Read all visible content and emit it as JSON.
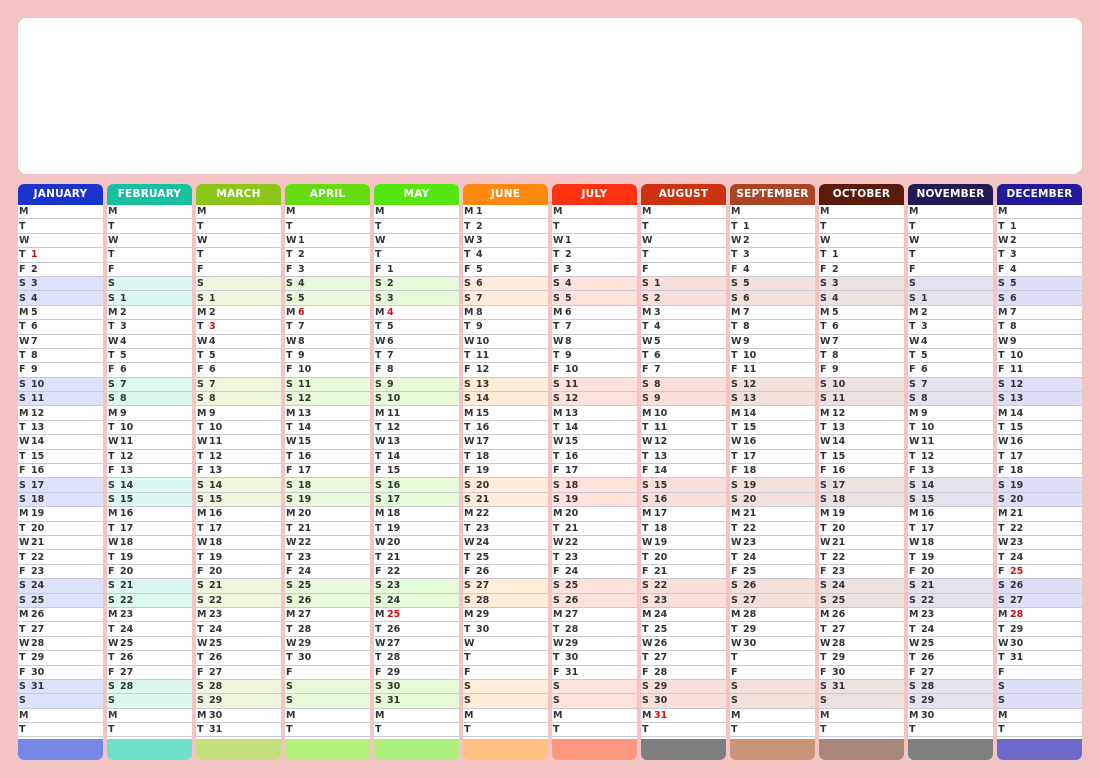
{
  "weekday_letters": [
    "M",
    "T",
    "W",
    "T",
    "F",
    "S",
    "S"
  ],
  "months": [
    {
      "name": "JANUARY",
      "color": "#1a33cc",
      "tint": "#dde2fb",
      "footer": "#7688e6",
      "start": 3,
      "days": 31,
      "holidays": [
        1
      ]
    },
    {
      "name": "FEBRUARY",
      "color": "#18c0a0",
      "tint": "#dcf8f1",
      "footer": "#6ee0c8",
      "start": 6,
      "days": 28,
      "holidays": []
    },
    {
      "name": "MARCH",
      "color": "#8dc61a",
      "tint": "#eef7de",
      "footer": "#c3e07c",
      "start": 6,
      "days": 31,
      "holidays": [
        3
      ]
    },
    {
      "name": "APRIL",
      "color": "#66dd11",
      "tint": "#e8fadb",
      "footer": "#b4f07c",
      "start": 2,
      "days": 30,
      "holidays": [
        6
      ]
    },
    {
      "name": "MAY",
      "color": "#55e611",
      "tint": "#e6fbd8",
      "footer": "#aef07e",
      "start": 4,
      "days": 31,
      "holidays": [
        4,
        25
      ]
    },
    {
      "name": "JUNE",
      "color": "#ff8811",
      "tint": "#ffecd9",
      "footer": "#ffc080",
      "start": 0,
      "days": 30,
      "holidays": []
    },
    {
      "name": "JULY",
      "color": "#ff3311",
      "tint": "#ffe1dc",
      "footer": "#ff9680",
      "start": 2,
      "days": 31,
      "holidays": []
    },
    {
      "name": "AUGUST",
      "color": "#cc3311",
      "tint": "#f7e0da",
      "footer": "#7e7e7e",
      "start": 5,
      "days": 31,
      "holidays": [
        31
      ]
    },
    {
      "name": "SEPTEMBER",
      "color": "#aa4422",
      "tint": "#f1e1da",
      "footer": "#c99478",
      "start": 1,
      "days": 30,
      "holidays": []
    },
    {
      "name": "OCTOBER",
      "color": "#5a1a0c",
      "tint": "#ebe1de",
      "footer": "#a8887a",
      "start": 3,
      "days": 31,
      "holidays": []
    },
    {
      "name": "NOVEMBER",
      "color": "#221a55",
      "tint": "#e4e2ec",
      "footer": "#808080",
      "start": 6,
      "days": 30,
      "holidays": []
    },
    {
      "name": "DECEMBER",
      "color": "#221a99",
      "tint": "#dddff6",
      "footer": "#6e6acb",
      "start": 1,
      "days": 31,
      "holidays": [
        25,
        28
      ]
    }
  ]
}
